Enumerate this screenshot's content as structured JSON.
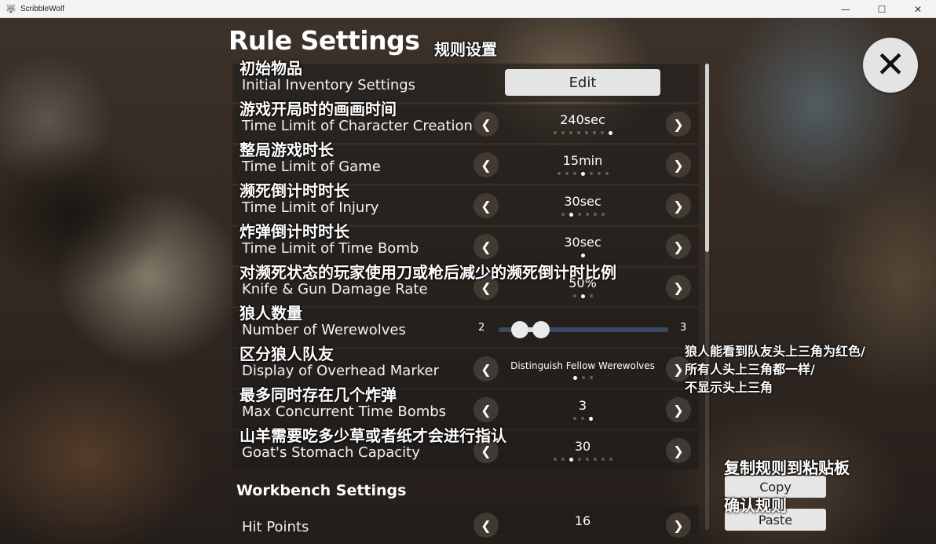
{
  "window": {
    "title": "ScribbleWolf",
    "minimize": "—",
    "maximize": "☐",
    "close": "✕"
  },
  "page": {
    "title": "Rule Settings",
    "title_cn": "规则设置",
    "close_glyph": "✕"
  },
  "rules": [
    {
      "cn": "初始物品",
      "en": "Initial Inventory Settings",
      "type": "button",
      "button_label": "Edit"
    },
    {
      "cn": "游戏开局时的画画时间",
      "en": "Time Limit of Character Creation",
      "type": "selector",
      "value": "240sec",
      "options_count": 8,
      "selected_index": 7
    },
    {
      "cn": "整局游戏时长",
      "en": "Time Limit of Game",
      "type": "selector",
      "value": "15min",
      "options_count": 7,
      "selected_index": 3
    },
    {
      "cn": "濒死倒计时时长",
      "en": "Time Limit of Injury",
      "type": "selector",
      "value": "30sec",
      "options_count": 6,
      "selected_index": 1
    },
    {
      "cn": "炸弹倒计时时长",
      "en": "Time Limit of Time Bomb",
      "type": "selector",
      "value": "30sec",
      "options_count": 1,
      "selected_index": 0
    },
    {
      "cn": "对濒死状态的玩家使用刀或枪后减少的濒死倒计时比例",
      "en": "Knife & Gun Damage Rate",
      "type": "selector",
      "value": "50%",
      "options_count": 3,
      "selected_index": 1
    },
    {
      "cn": "狼人数量",
      "en": "Number of Werewolves",
      "type": "slider",
      "min": "2",
      "max": "3"
    },
    {
      "cn": "区分狼人队友",
      "en": "Display of Overhead Marker",
      "type": "selector",
      "value": "Distinguish Fellow Werewolves",
      "options_count": 3,
      "selected_index": 0
    },
    {
      "cn": "最多同时存在几个炸弹",
      "en": "Max Concurrent Time Bombs",
      "type": "selector",
      "value": "3",
      "options_count": 3,
      "selected_index": 2
    },
    {
      "cn": "山羊需要吃多少草或者纸才会进行指认",
      "en": "Goat's Stomach Capacity",
      "type": "selector",
      "value": "30",
      "options_count": 8,
      "selected_index": 2
    }
  ],
  "workbench": {
    "section_title": "Workbench Settings",
    "rows": [
      {
        "en": "Hit Points",
        "value": "16"
      }
    ]
  },
  "marker_note": [
    "狼人能看到队友头上三角为红色/",
    "所有人头上三角都一样/",
    "不显示头上三角"
  ],
  "side_actions": {
    "copy_cn": "复制规则到粘贴板",
    "copy_label": "Copy",
    "paste_cn": "确认规则",
    "paste_label": "Paste"
  },
  "icons": {
    "prev": "chevron-left-icon",
    "next": "chevron-right-icon"
  }
}
